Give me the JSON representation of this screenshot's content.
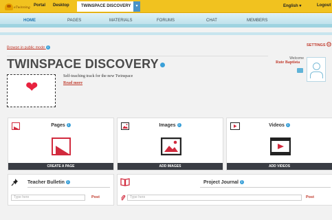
{
  "topbar": {
    "logo_text": "eTwinning",
    "portal": "Portal",
    "desktop": "Desktop",
    "twinspace_tab": "TWINSPACE DISCOVERY",
    "dropdown_glyph": "▾",
    "language": "English ▾",
    "logout": "Logout",
    "accent_color": "#f1c21f"
  },
  "menu": {
    "items": [
      {
        "label": "HOME"
      },
      {
        "label": "PAGES"
      },
      {
        "label": "MATERIALS"
      },
      {
        "label": "FORUMS"
      },
      {
        "label": "CHAT"
      },
      {
        "label": "MEMBERS"
      }
    ],
    "active": "HOME"
  },
  "header": {
    "browse_public": "Browse in public mode",
    "info_glyph": "i",
    "settings": "SETTINGS",
    "gear_glyph": "⚙",
    "title": "TWINSPACE DISCOVERY",
    "welcome": "Welcome",
    "user_name": "Rute Baptista"
  },
  "intro": {
    "description": "Self-teaching track for the new Twinspace",
    "read_more": "Read more",
    "heart_glyph": "❤"
  },
  "cards": [
    {
      "title": "Pages",
      "action": "CREATE A PAGE",
      "icon": "page-icon"
    },
    {
      "title": "Images",
      "action": "ADD IMAGES",
      "icon": "image-icon"
    },
    {
      "title": "Videos",
      "action": "ADD VIDEOS",
      "icon": "video-icon"
    }
  ],
  "bulletin": {
    "title": "Teacher Bulletin",
    "placeholder": "Type here",
    "post": "Post",
    "icon": "pushpin-icon"
  },
  "journal": {
    "title": "Project Journal",
    "placeholder": "Type here",
    "post": "Post",
    "icon": "book-icon"
  }
}
